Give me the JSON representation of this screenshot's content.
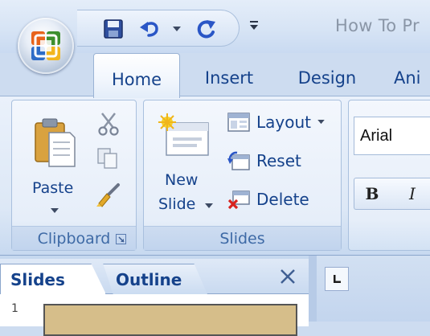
{
  "window": {
    "title": "How To Pr"
  },
  "tabs": [
    "Home",
    "Insert",
    "Design",
    "Ani"
  ],
  "ribbon": {
    "clipboard": {
      "paste_label": "Paste",
      "group_label": "Clipboard"
    },
    "slides": {
      "new_slide_line1": "New",
      "new_slide_line2": "Slide",
      "layout_label": "Layout",
      "reset_label": "Reset",
      "delete_label": "Delete",
      "group_label": "Slides"
    },
    "font": {
      "font_name": "Arial",
      "bold_label": "B",
      "italic_label": "I"
    }
  },
  "pane": {
    "slides_tab": "Slides",
    "outline_tab": "Outline",
    "close_glyph": "✕",
    "slide_number": "1"
  },
  "colors": {
    "accent": "#15428b",
    "group_label": "#3e6aa6",
    "ribbon_bg": "#dde8f6"
  }
}
